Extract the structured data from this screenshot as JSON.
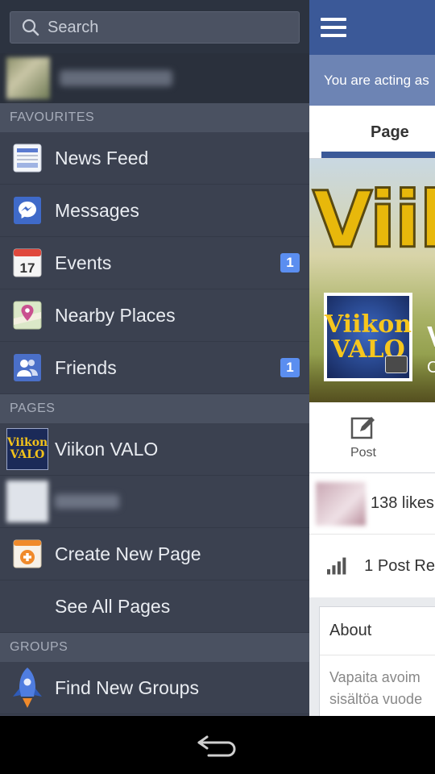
{
  "drawer": {
    "search": {
      "placeholder": "Search"
    },
    "favourites_header": "FAVOURITES",
    "favourites": [
      {
        "label": "News Feed",
        "icon": "news-feed-icon"
      },
      {
        "label": "Messages",
        "icon": "messages-icon"
      },
      {
        "label": "Events",
        "icon": "events-calendar-icon",
        "calendar_day": "17",
        "badge": "1"
      },
      {
        "label": "Nearby Places",
        "icon": "nearby-places-icon"
      },
      {
        "label": "Friends",
        "icon": "friends-icon",
        "badge": "1"
      }
    ],
    "pages_header": "PAGES",
    "pages": [
      {
        "label": "Viikon VALO",
        "thumb_line1": "Viikon",
        "thumb_line2": "VALO"
      },
      {
        "label": "Create New Page",
        "icon": "create-page-icon"
      },
      {
        "label": "See All Pages"
      }
    ],
    "groups_header": "GROUPS",
    "groups": [
      {
        "label": "Find New Groups",
        "icon": "rocket-icon"
      }
    ]
  },
  "content": {
    "acting_banner": "You are acting as",
    "tab_page": "Page",
    "cover_text": "Viik",
    "logo_line1": "Viikon",
    "logo_line2": "VALO",
    "cover_name": "V",
    "cover_sub": "C",
    "post_label": "Post",
    "likes": "138 likes",
    "reach": "1 Post Re",
    "about_title": "About",
    "about_line1": "Vapaita avoim",
    "about_line2": "sisältöa vuode"
  },
  "colors": {
    "drawer_bg": "#3b4150",
    "header_bg": "#4a5161",
    "brand_blue": "#3b5998",
    "badge_blue": "#5b8ef0"
  }
}
